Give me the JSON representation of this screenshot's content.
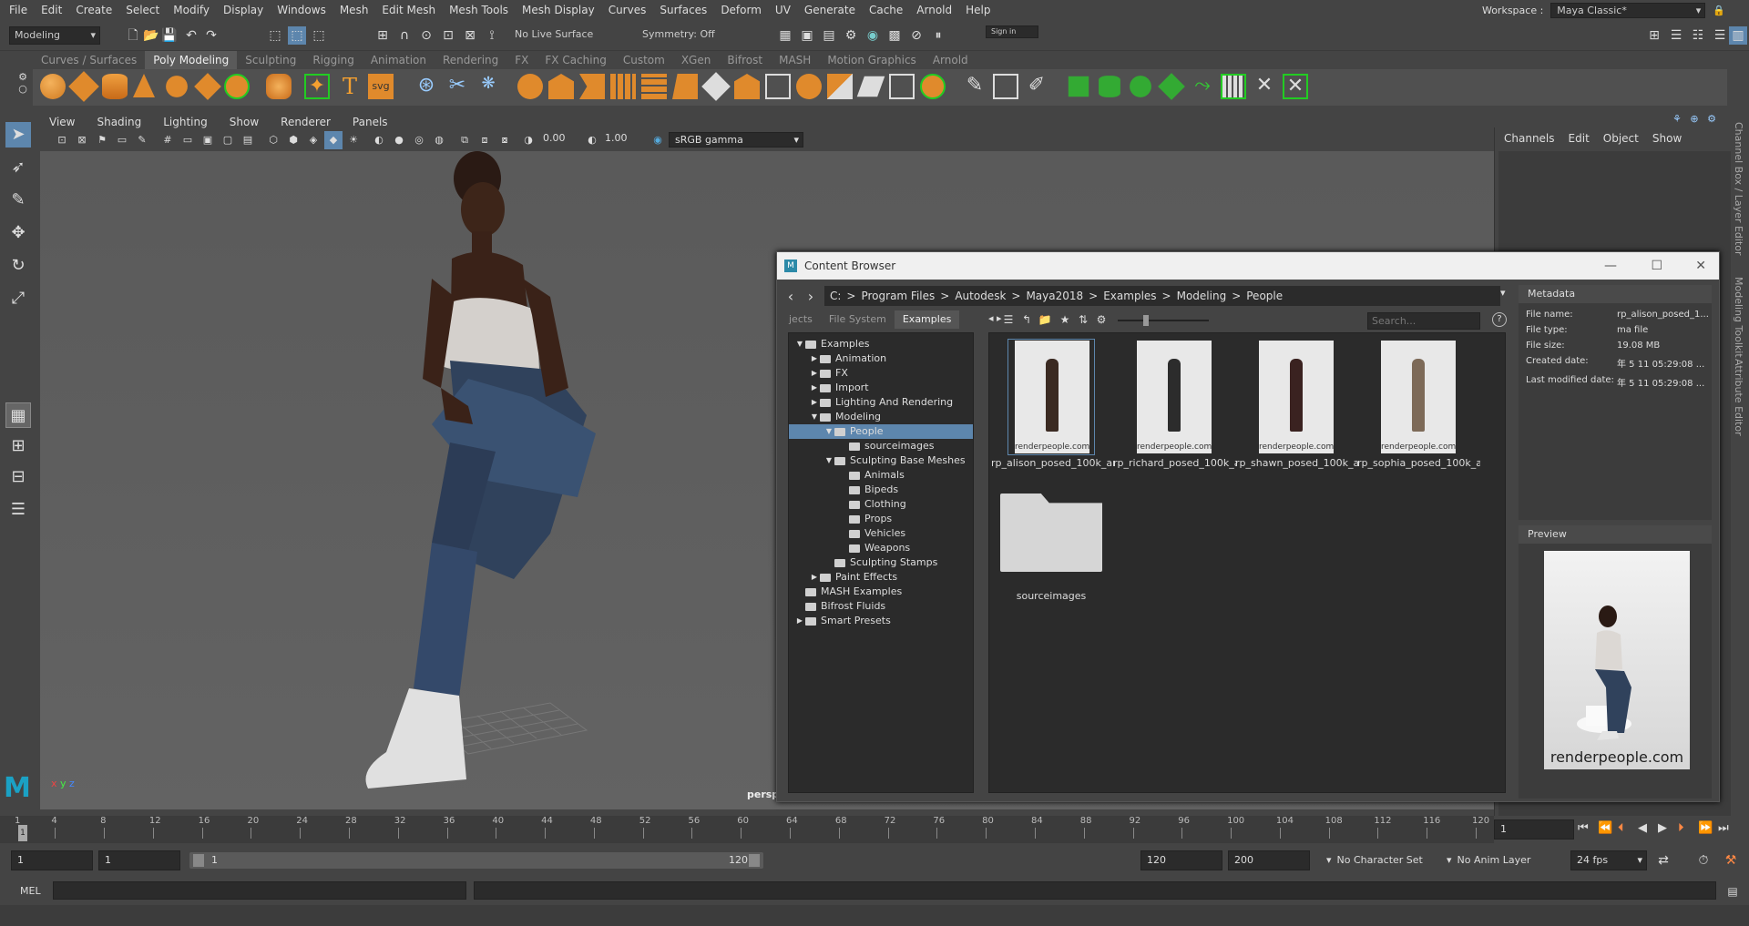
{
  "menubar": {
    "items": [
      "File",
      "Edit",
      "Create",
      "Select",
      "Modify",
      "Display",
      "Windows",
      "Mesh",
      "Edit Mesh",
      "Mesh Tools",
      "Mesh Display",
      "Curves",
      "Surfaces",
      "Deform",
      "UV",
      "Generate",
      "Cache",
      "Arnold",
      "Help"
    ],
    "workspace_label": "Workspace :",
    "workspace_value": "Maya Classic*"
  },
  "statusline": {
    "menuset": "Modeling",
    "live_surface": "No Live Surface",
    "symmetry": "Symmetry: Off",
    "sign_in": "Sign in"
  },
  "shelf": {
    "tabs": [
      "Curves / Surfaces",
      "Poly Modeling",
      "Sculpting",
      "Rigging",
      "Animation",
      "Rendering",
      "FX",
      "FX Caching",
      "Custom",
      "XGen",
      "Bifrost",
      "MASH",
      "Motion Graphics",
      "Arnold"
    ],
    "active_tab": "Poly Modeling",
    "svg_label": "svg",
    "text_label": "T"
  },
  "viewport": {
    "menus": [
      "View",
      "Shading",
      "Lighting",
      "Show",
      "Renderer",
      "Panels"
    ],
    "exposure": "0.00",
    "gamma": "1.00",
    "colorspace": "sRGB gamma",
    "camera": "persp",
    "axis_x": "x",
    "axis_y": "y",
    "axis_z": "z"
  },
  "channels": {
    "menus": [
      "Channels",
      "Edit",
      "Object",
      "Show"
    ]
  },
  "side_tabs": [
    "Channel Box / Layer Editor",
    "Modeling Toolkit",
    "Attribute Editor"
  ],
  "content_browser": {
    "title": "Content Browser",
    "path": [
      "C:",
      ">",
      "Program Files",
      ">",
      "Autodesk",
      ">",
      "Maya2018",
      ">",
      "Examples",
      ">",
      "Modeling",
      ">",
      "People"
    ],
    "tabs": [
      "jects",
      "File System",
      "Examples"
    ],
    "active_tab": "Examples",
    "search_placeholder": "Search...",
    "tree": [
      {
        "label": "Examples",
        "depth": 0,
        "arrow": "down"
      },
      {
        "label": "Animation",
        "depth": 1,
        "arrow": "right"
      },
      {
        "label": "FX",
        "depth": 1,
        "arrow": "right"
      },
      {
        "label": "Import",
        "depth": 1,
        "arrow": "right"
      },
      {
        "label": "Lighting And Rendering",
        "depth": 1,
        "arrow": "right"
      },
      {
        "label": "Modeling",
        "depth": 1,
        "arrow": "down"
      },
      {
        "label": "People",
        "depth": 2,
        "arrow": "down",
        "selected": true
      },
      {
        "label": "sourceimages",
        "depth": 3,
        "arrow": ""
      },
      {
        "label": "Sculpting Base Meshes",
        "depth": 2,
        "arrow": "down"
      },
      {
        "label": "Animals",
        "depth": 3,
        "arrow": ""
      },
      {
        "label": "Bipeds",
        "depth": 3,
        "arrow": ""
      },
      {
        "label": "Clothing",
        "depth": 3,
        "arrow": ""
      },
      {
        "label": "Props",
        "depth": 3,
        "arrow": ""
      },
      {
        "label": "Vehicles",
        "depth": 3,
        "arrow": ""
      },
      {
        "label": "Weapons",
        "depth": 3,
        "arrow": ""
      },
      {
        "label": "Sculpting Stamps",
        "depth": 2,
        "arrow": ""
      },
      {
        "label": "Paint Effects",
        "depth": 1,
        "arrow": "right"
      },
      {
        "label": "MASH Examples",
        "depth": 0,
        "arrow": ""
      },
      {
        "label": "Bifrost Fluids",
        "depth": 0,
        "arrow": ""
      },
      {
        "label": "Smart Presets",
        "depth": 0,
        "arrow": "right"
      }
    ],
    "files": [
      {
        "label": "rp_alison_posed_100k_ar...",
        "watermark": "renderpeople.com",
        "color": "#e8e8e8",
        "fig": "#3b2a22"
      },
      {
        "label": "rp_richard_posed_100k_a...",
        "watermark": "renderpeople.com",
        "color": "#e8e8e8",
        "fig": "#2c2c2c"
      },
      {
        "label": "rp_shawn_posed_100k_ar...",
        "watermark": "renderpeople.com",
        "color": "#e8e8e8",
        "fig": "#3a2220"
      },
      {
        "label": "rp_sophia_posed_100k_ar...",
        "watermark": "renderpeople.com",
        "color": "#e8e8e8",
        "fig": "#7d6a58"
      }
    ],
    "folder_label": "sourceimages",
    "metadata": {
      "header": "Metadata",
      "rows": [
        {
          "k": "File name:",
          "v": "rp_alison_posed_1..."
        },
        {
          "k": "File type:",
          "v": "ma file"
        },
        {
          "k": "File size:",
          "v": "19.08 MB"
        },
        {
          "k": "Created date:",
          "v": "年 5 11 05:29:08 ..."
        },
        {
          "k": "Last modified date:",
          "v": "年 5 11 05:29:08 ..."
        }
      ]
    },
    "preview": {
      "header": "Preview",
      "watermark": "renderpeople.com"
    }
  },
  "timeline": {
    "ticks": [
      "1",
      "4",
      "8",
      "12",
      "16",
      "20",
      "24",
      "28",
      "32",
      "36",
      "40",
      "44",
      "48",
      "52",
      "56",
      "60",
      "64",
      "68",
      "72",
      "76",
      "80",
      "84",
      "88",
      "92",
      "96",
      "100",
      "104",
      "108",
      "112",
      "116",
      "120"
    ],
    "current_frame": "1"
  },
  "range": {
    "start": "1",
    "playback_start": "1",
    "slider_start": "1",
    "slider_end": "120",
    "playback_end": "120",
    "end": "200",
    "character_set": "No Character Set",
    "anim_layer": "No Anim Layer",
    "fps": "24 fps"
  },
  "cmdline": {
    "label": "MEL"
  }
}
